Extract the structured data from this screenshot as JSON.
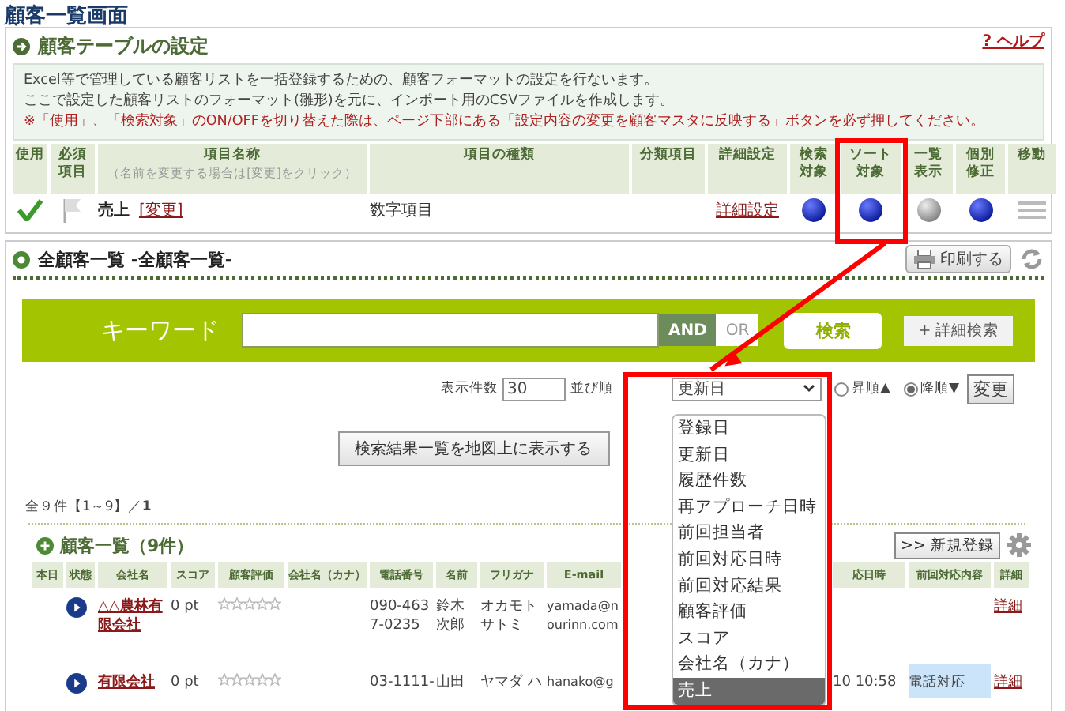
{
  "page_title": "顧客一覧画面",
  "table_settings": {
    "title": "顧客テーブルの設定",
    "help_link": "? ヘルプ",
    "description": [
      "Excel等で管理している顧客リストを一括登録するための、顧客フォーマットの設定を行ないます。",
      "ここで設定した顧客リストのフォーマット(雛形)を元に、インポート用のCSVファイルを作成します。"
    ],
    "warning": "※「使用」、「検索対象」のON/OFFを切り替えた際は、ページ下部にある「設定内容の変更を顧客マスタに反映する」ボタンを必ず押してください。",
    "columns": [
      {
        "label": "使用"
      },
      {
        "label": "必須項目"
      },
      {
        "label": "項目名称",
        "note": "（名前を変更する場合は[変更]をクリック）"
      },
      {
        "label": "項目の種類"
      },
      {
        "label": "分類項目"
      },
      {
        "label": "詳細設定"
      },
      {
        "label": "検索対象"
      },
      {
        "label": "ソート対象"
      },
      {
        "label": "一覧表示"
      },
      {
        "label": "個別修正"
      },
      {
        "label": "移動"
      }
    ],
    "row": {
      "used": true,
      "required": false,
      "name": "売上",
      "change_link": "[変更]",
      "type": "数字項目",
      "detail_link": "詳細設定",
      "toggles": [
        {
          "on": true
        },
        {
          "on": true
        },
        {
          "on": false
        },
        {
          "on": true
        }
      ]
    }
  },
  "all_customers": {
    "title": "全顧客一覧 -全顧客一覧-",
    "print_button": "印刷する",
    "search": {
      "label": "キーワード",
      "modes": [
        {
          "label": "AND",
          "selected": true
        },
        {
          "label": "OR",
          "selected": false
        }
      ],
      "search_button": "検索",
      "advanced_button": "+ 詳細検索"
    },
    "sort": {
      "count_label": "表示件数",
      "count_value": "30",
      "order_label": "並び順",
      "order_value": "更新日",
      "options": [
        {
          "label": "登録日",
          "selected": false
        },
        {
          "label": "更新日",
          "selected": false
        },
        {
          "label": "履歴件数",
          "selected": false
        },
        {
          "label": "再アプローチ日時",
          "selected": false
        },
        {
          "label": "前回担当者",
          "selected": false
        },
        {
          "label": "前回対応日時",
          "selected": false
        },
        {
          "label": "前回対応結果",
          "selected": false
        },
        {
          "label": "顧客評価",
          "selected": false
        },
        {
          "label": "スコア",
          "selected": false
        },
        {
          "label": "会社名（カナ）",
          "selected": false
        },
        {
          "label": "売上",
          "selected": true
        }
      ],
      "directions": [
        {
          "label": "昇順▲",
          "selected": false
        },
        {
          "label": "降順▼",
          "selected": true
        }
      ],
      "change_button": "変更"
    },
    "map_button": "検索結果一覧を地図上に表示する",
    "result_count": "全９件【1～9】／**1**",
    "customer_list": {
      "title": "顧客一覧（9件）",
      "new_button": ">> 新規登録",
      "columns": [
        "本日",
        "状態",
        "会社名",
        "スコア",
        "顧客評価",
        "会社名（カナ）",
        "電話番号",
        "名前",
        "フリガナ",
        "E-mail",
        "",
        "応日時",
        "前回対応内容",
        "詳細"
      ],
      "rows": [
        {
          "company": "△△農林有限会社",
          "score": "0 pt",
          "stars": 0,
          "phone": "090-4637-0235",
          "name": "鈴木次郎",
          "kana": "オカモトサトミ",
          "email": "yamada@nourinn.com",
          "last_date": "",
          "last_content": "",
          "detail": "詳細"
        },
        {
          "company": "有限会社",
          "score": "0 pt",
          "stars": 0,
          "phone": "03-1111-",
          "name": "山田",
          "kana": "ヤマダ ハ",
          "email": "hanako@g",
          "last_date": "10 10:58",
          "last_content": "電話対応",
          "detail": "詳細"
        }
      ]
    }
  }
}
